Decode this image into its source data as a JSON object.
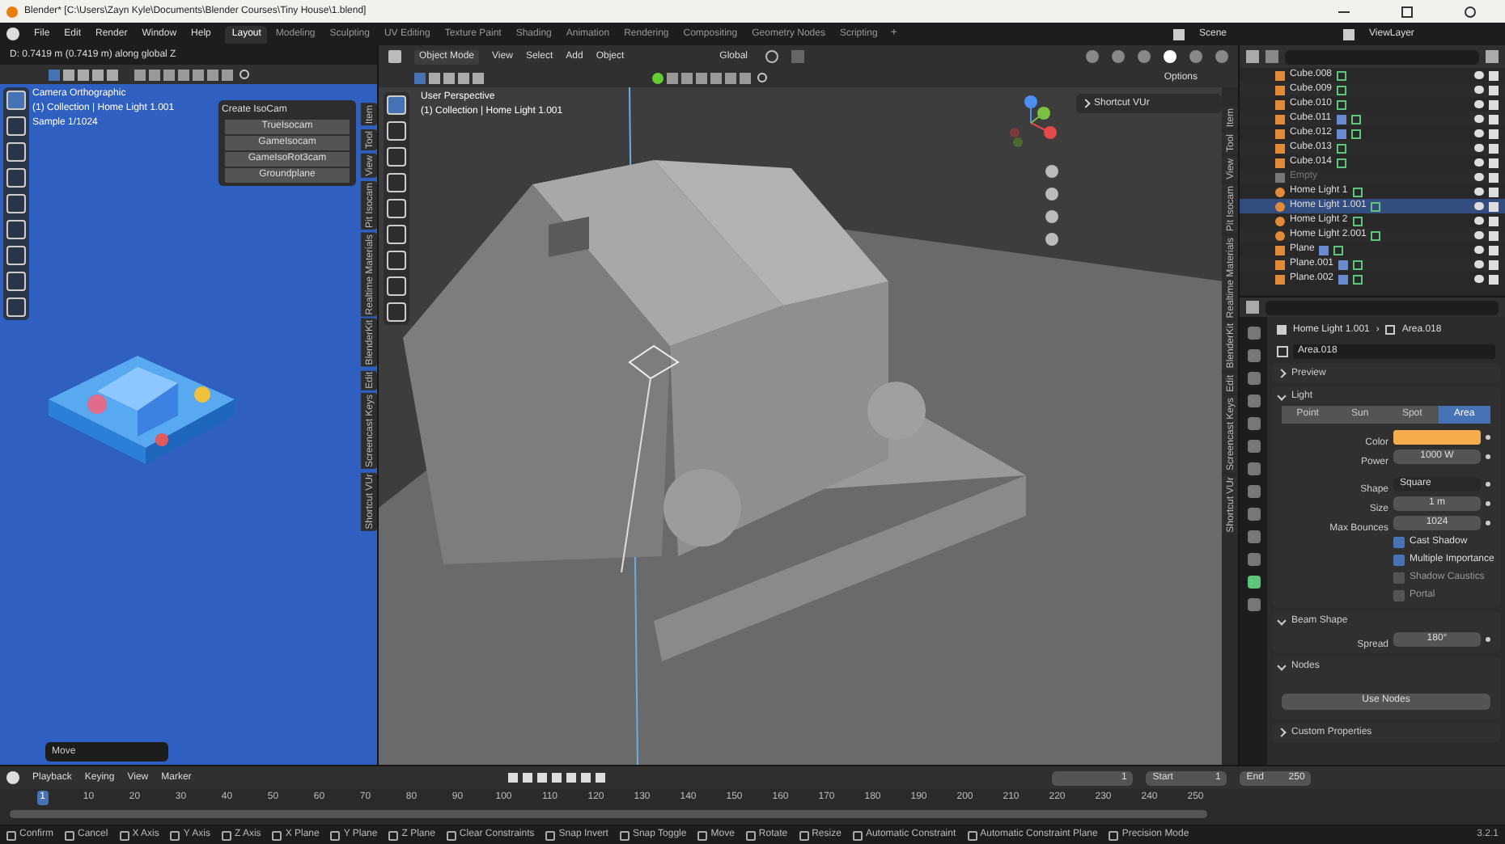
{
  "title_bar": {
    "title": "Blender* [C:\\Users\\Zayn Kyle\\Documents\\Blender Courses\\Tiny House\\1.blend]"
  },
  "menu": [
    "File",
    "Edit",
    "Render",
    "Window",
    "Help"
  ],
  "workspaces": [
    {
      "label": "Layout",
      "selected": true
    },
    {
      "label": "Modeling",
      "selected": false
    },
    {
      "label": "Sculpting",
      "selected": false
    },
    {
      "label": "UV Editing",
      "selected": false
    },
    {
      "label": "Texture Paint",
      "selected": false
    },
    {
      "label": "Shading",
      "selected": false
    },
    {
      "label": "Animation",
      "selected": false
    },
    {
      "label": "Rendering",
      "selected": false
    },
    {
      "label": "Compositing",
      "selected": false
    },
    {
      "label": "Geometry Nodes",
      "selected": false
    },
    {
      "label": "Scripting",
      "selected": false
    }
  ],
  "add_workspace": "+",
  "scene": "Scene",
  "view_layer": "ViewLayer",
  "left_viewport": {
    "status": "D: 0.7419 m (0.7419 m) along global Z",
    "overlay": [
      "Camera Orthographic",
      "(1) Collection | Home Light 1.001",
      "Sample 1/1024"
    ],
    "isocam_panel": {
      "title": "Create IsoCam",
      "buttons": [
        "TrueIsocam",
        "GameIsocam",
        "GameIsoRot3cam",
        "Groundplane"
      ]
    },
    "side_tabs": [
      "Item",
      "Tool",
      "View",
      "Pit Isocam",
      "Realtime Materials",
      "BlenderKit",
      "Edit",
      "Screencast Keys",
      "Shortcut VUr"
    ],
    "last_operator": "Move"
  },
  "main_viewport": {
    "mode": "Object Mode",
    "menu": [
      "View",
      "Select",
      "Add",
      "Object"
    ],
    "orientation": "Global",
    "options": "Options",
    "overlay": [
      "User Perspective",
      "(1) Collection | Home Light 1.001"
    ],
    "panel": "Shortcut VUr",
    "side_tabs": [
      "Item",
      "Tool",
      "View",
      "Pit Isocam",
      "Realtime Materials",
      "BlenderKit",
      "Edit",
      "Screencast Keys",
      "Shortcut VUr"
    ]
  },
  "outliner": {
    "rows": [
      {
        "name": "Cube.008",
        "kind": "mesh",
        "modifier": false,
        "selected": false
      },
      {
        "name": "Cube.009",
        "kind": "mesh",
        "modifier": false,
        "selected": false
      },
      {
        "name": "Cube.010",
        "kind": "mesh",
        "modifier": false,
        "selected": false
      },
      {
        "name": "Cube.011",
        "kind": "mesh",
        "modifier": true,
        "selected": false
      },
      {
        "name": "Cube.012",
        "kind": "mesh",
        "modifier": true,
        "selected": false
      },
      {
        "name": "Cube.013",
        "kind": "mesh",
        "modifier": false,
        "selected": false
      },
      {
        "name": "Cube.014",
        "kind": "mesh",
        "modifier": false,
        "selected": false
      },
      {
        "name": "Empty",
        "kind": "empty",
        "modifier": false,
        "selected": false
      },
      {
        "name": "Home Light 1",
        "kind": "light",
        "modifier": false,
        "selected": false
      },
      {
        "name": "Home Light 1.001",
        "kind": "light",
        "modifier": false,
        "selected": true
      },
      {
        "name": "Home Light 2",
        "kind": "light",
        "modifier": false,
        "selected": false
      },
      {
        "name": "Home Light 2.001",
        "kind": "light",
        "modifier": false,
        "selected": false
      },
      {
        "name": "Plane",
        "kind": "mesh",
        "modifier": true,
        "selected": false
      },
      {
        "name": "Plane.001",
        "kind": "mesh",
        "modifier": true,
        "selected": false
      },
      {
        "name": "Plane.002",
        "kind": "mesh",
        "modifier": true,
        "selected": false
      }
    ]
  },
  "properties": {
    "object": "Home Light 1.001",
    "data": "Area.018",
    "datablock": "Area.018",
    "breadcrumb_separator": "›",
    "sections": [
      {
        "title": "Preview",
        "expanded": false
      },
      {
        "title": "Light",
        "kind": "light",
        "expanded": true
      },
      {
        "title": "Beam Shape",
        "kind": "beam",
        "expanded": true
      },
      {
        "title": "Nodes",
        "kind": "nodes",
        "expanded": true
      },
      {
        "title": "Custom Properties",
        "expanded": false
      }
    ],
    "light_types": [
      {
        "label": "Point",
        "selected": false
      },
      {
        "label": "Sun",
        "selected": false
      },
      {
        "label": "Spot",
        "selected": false
      },
      {
        "label": "Area",
        "selected": true
      }
    ],
    "color_label": "Color",
    "color": "#f5ad4d",
    "fields_top": [
      {
        "label": "Power",
        "value": "1000 W"
      }
    ],
    "shape": {
      "label": "Shape",
      "value": "Square"
    },
    "fields": [
      {
        "label": "Size",
        "value": "1 m"
      },
      {
        "label": "Max Bounces",
        "value": "1024"
      }
    ],
    "checkboxes": [
      {
        "label": "Cast Shadow",
        "checked": true
      },
      {
        "label": "Multiple Importance",
        "checked": true
      },
      {
        "label": "Shadow Caustics",
        "checked": false
      },
      {
        "label": "Portal",
        "checked": false
      }
    ],
    "spread": {
      "label": "Spread",
      "value": "180°"
    },
    "use_nodes": "Use Nodes"
  },
  "timeline": {
    "menu": [
      "Playback",
      "Keying",
      "View",
      "Marker"
    ],
    "frame": "1",
    "start_label": "Start",
    "start": "1",
    "end_label": "End",
    "end": "250",
    "ruler": [
      {
        "label": "1",
        "selected": true
      },
      {
        "label": "10",
        "selected": false
      },
      {
        "label": "20",
        "selected": false
      },
      {
        "label": "30",
        "selected": false
      },
      {
        "label": "40",
        "selected": false
      },
      {
        "label": "50",
        "selected": false
      },
      {
        "label": "60",
        "selected": false
      },
      {
        "label": "70",
        "selected": false
      },
      {
        "label": "80",
        "selected": false
      },
      {
        "label": "90",
        "selected": false
      },
      {
        "label": "100",
        "selected": false
      },
      {
        "label": "110",
        "selected": false
      },
      {
        "label": "120",
        "selected": false
      },
      {
        "label": "130",
        "selected": false
      },
      {
        "label": "140",
        "selected": false
      },
      {
        "label": "150",
        "selected": false
      },
      {
        "label": "160",
        "selected": false
      },
      {
        "label": "170",
        "selected": false
      },
      {
        "label": "180",
        "selected": false
      },
      {
        "label": "190",
        "selected": false
      },
      {
        "label": "200",
        "selected": false
      },
      {
        "label": "210",
        "selected": false
      },
      {
        "label": "220",
        "selected": false
      },
      {
        "label": "230",
        "selected": false
      },
      {
        "label": "240",
        "selected": false
      },
      {
        "label": "250",
        "selected": false
      }
    ]
  },
  "status_bar": {
    "items": [
      "Confirm",
      "Cancel",
      "X Axis",
      "Y Axis",
      "Z Axis",
      "X Plane",
      "Y Plane",
      "Z Plane",
      "Clear Constraints",
      "Snap Invert",
      "Snap Toggle",
      "Move",
      "Rotate",
      "Resize",
      "Automatic Constraint",
      "Automatic Constraint Plane",
      "Precision Mode"
    ],
    "version": "3.2.1"
  }
}
